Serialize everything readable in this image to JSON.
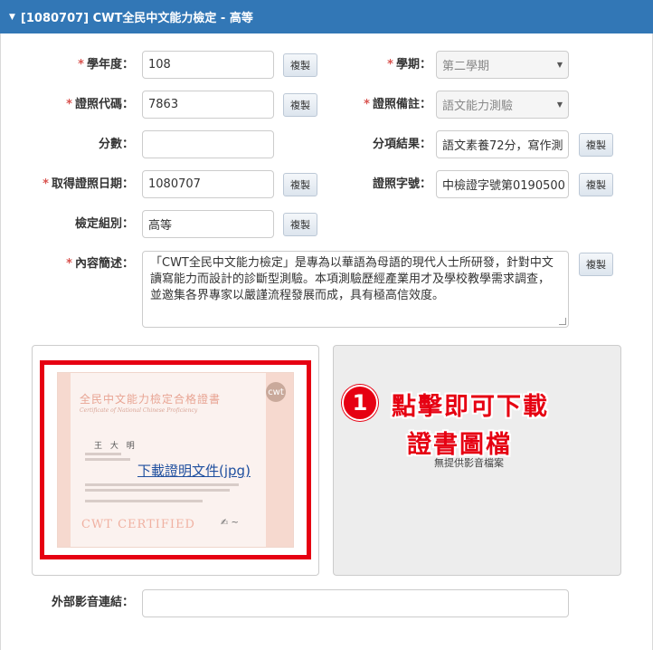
{
  "panel": {
    "title": "[1080707] CWT全民中文能力檢定 - 高等"
  },
  "form": {
    "required_mark": "*",
    "copy_label": "複製",
    "school_year": {
      "label": "學年度：",
      "value": "108"
    },
    "semester": {
      "label": "學期：",
      "value": "第二學期"
    },
    "license_code": {
      "label": "證照代碼：",
      "value": "7863"
    },
    "license_note": {
      "label": "證照備註：",
      "value": "語文能力測驗"
    },
    "score": {
      "label": "分數：",
      "value": ""
    },
    "sub_result": {
      "label": "分項結果：",
      "value": "語文素養72分，寫作測"
    },
    "obtain_date": {
      "label": "取得證照日期：",
      "value": "1080707"
    },
    "license_number": {
      "label": "證照字號：",
      "value": "中檢證字號第0190500"
    },
    "test_group": {
      "label": "檢定組別：",
      "value": "高等"
    },
    "description": {
      "label": "內容簡述：",
      "value": "「CWT全民中文能力檢定」是專為以華語為母語的現代人士所研發，針對中文讀寫能力而設計的診斷型測驗。本項測驗歷經產業用才及學校教學需求調查，並邀集各界專家以嚴謹流程發展而成，具有極高信效度。"
    },
    "external_media": {
      "label": "外部影音連結：",
      "value": ""
    }
  },
  "certificate": {
    "title": "全民中文能力檢定合格證書",
    "subtitle": "Certificate of National Chinese Proficiency",
    "name": "王 大 明",
    "footer": "CWT CERTIFIED",
    "download_link": "下載證明文件(jpg)"
  },
  "media": {
    "no_file": "無提供影音檔案"
  },
  "annotation": {
    "step": "1",
    "line1": "點擊即可下載",
    "line2": "證書圖檔"
  }
}
